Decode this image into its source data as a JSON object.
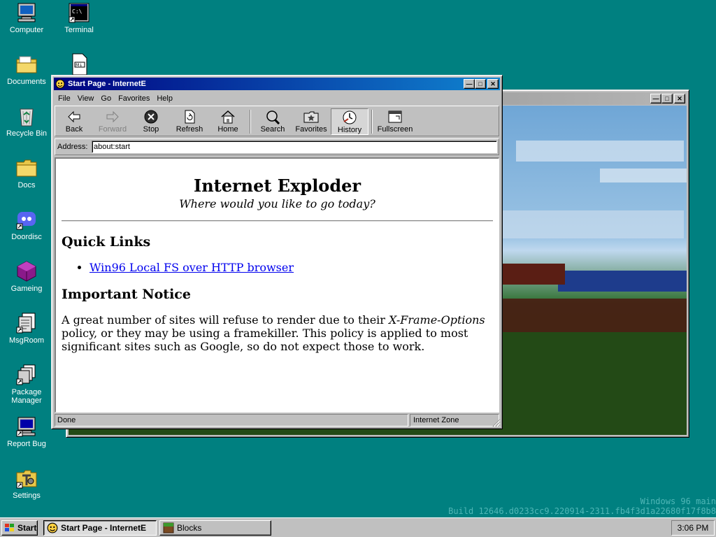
{
  "desktop": {
    "icons": [
      {
        "label": "Computer"
      },
      {
        "label": "Terminal"
      },
      {
        "label": "Documents"
      },
      {
        "label": "Recycle Bin"
      },
      {
        "label": "Docs"
      },
      {
        "label": "Doordisc"
      },
      {
        "label": "Gameing"
      },
      {
        "label": "MsgRoom"
      },
      {
        "label": "Package Manager"
      },
      {
        "label": "Report Bug"
      },
      {
        "label": "Settings"
      }
    ],
    "watermark": {
      "line1": "Windows 96 main",
      "line2": "Build 12646.d0233cc9.220914-2311.fb4f3d1a22680f17f8b8"
    },
    "bg_color": "#008080"
  },
  "browser": {
    "title": "Start Page - InternetE",
    "menu": [
      "File",
      "View",
      "Go",
      "Favorites",
      "Help"
    ],
    "toolbar": {
      "back": "Back",
      "forward": "Forward",
      "stop": "Stop",
      "refresh": "Refresh",
      "home": "Home",
      "search": "Search",
      "favorites": "Favorites",
      "history": "History",
      "fullscreen": "Fullscreen"
    },
    "address_label": "Address:",
    "address_value": "about:start",
    "page": {
      "heading": "Internet Exploder",
      "subtitle": "Where would you like to go today?",
      "quick_links_heading": "Quick Links",
      "link_1": "Win96 Local FS over HTTP browser",
      "notice_heading": "Important Notice",
      "notice_text_1": "A great number of sites will refuse to render due to their ",
      "notice_em": "X-Frame-Options",
      "notice_text_2": " policy, or they may be using a framekiller. This policy is applied to most significant sites such as Google, so do not expect those to work."
    },
    "status_left": "Done",
    "status_right": "Internet Zone"
  },
  "background_window": {
    "title": ""
  },
  "taskbar": {
    "start": "Start",
    "tasks": [
      {
        "label": "Start Page - InternetE"
      },
      {
        "label": "Blocks"
      }
    ],
    "clock": "3:06 PM"
  }
}
